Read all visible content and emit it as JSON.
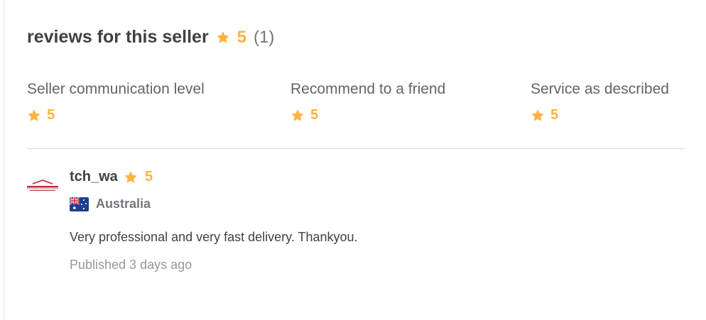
{
  "colors": {
    "star": "#ffb33e",
    "text": "#404145",
    "muted": "#74767e",
    "divider": "#dadbdd"
  },
  "header": {
    "title": "reviews for this seller",
    "rating": "5",
    "count": "(1)",
    "icon": "star-icon"
  },
  "breakdown": [
    {
      "label": "Seller communication level",
      "rating": "5"
    },
    {
      "label": "Recommend to a friend",
      "rating": "5"
    },
    {
      "label": "Service as described",
      "rating": "5"
    }
  ],
  "review": {
    "avatar_icon": "company-logo-icon",
    "username": "tch_wa",
    "rating": "5",
    "country": "Australia",
    "flag_icon": "australia-flag-icon",
    "text": "Very professional and very fast delivery. Thankyou.",
    "published": "Published 3 days ago"
  }
}
